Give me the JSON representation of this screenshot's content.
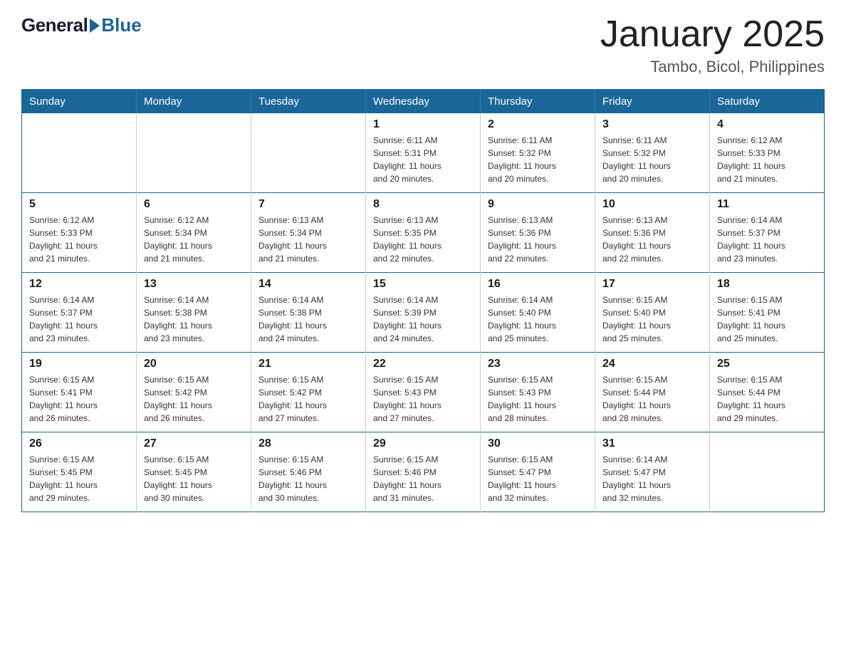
{
  "header": {
    "logo_general": "General",
    "logo_blue": "Blue",
    "month_title": "January 2025",
    "location": "Tambo, Bicol, Philippines"
  },
  "days_of_week": [
    "Sunday",
    "Monday",
    "Tuesday",
    "Wednesday",
    "Thursday",
    "Friday",
    "Saturday"
  ],
  "weeks": [
    [
      {
        "day": "",
        "info": ""
      },
      {
        "day": "",
        "info": ""
      },
      {
        "day": "",
        "info": ""
      },
      {
        "day": "1",
        "info": "Sunrise: 6:11 AM\nSunset: 5:31 PM\nDaylight: 11 hours\nand 20 minutes."
      },
      {
        "day": "2",
        "info": "Sunrise: 6:11 AM\nSunset: 5:32 PM\nDaylight: 11 hours\nand 20 minutes."
      },
      {
        "day": "3",
        "info": "Sunrise: 6:11 AM\nSunset: 5:32 PM\nDaylight: 11 hours\nand 20 minutes."
      },
      {
        "day": "4",
        "info": "Sunrise: 6:12 AM\nSunset: 5:33 PM\nDaylight: 11 hours\nand 21 minutes."
      }
    ],
    [
      {
        "day": "5",
        "info": "Sunrise: 6:12 AM\nSunset: 5:33 PM\nDaylight: 11 hours\nand 21 minutes."
      },
      {
        "day": "6",
        "info": "Sunrise: 6:12 AM\nSunset: 5:34 PM\nDaylight: 11 hours\nand 21 minutes."
      },
      {
        "day": "7",
        "info": "Sunrise: 6:13 AM\nSunset: 5:34 PM\nDaylight: 11 hours\nand 21 minutes."
      },
      {
        "day": "8",
        "info": "Sunrise: 6:13 AM\nSunset: 5:35 PM\nDaylight: 11 hours\nand 22 minutes."
      },
      {
        "day": "9",
        "info": "Sunrise: 6:13 AM\nSunset: 5:36 PM\nDaylight: 11 hours\nand 22 minutes."
      },
      {
        "day": "10",
        "info": "Sunrise: 6:13 AM\nSunset: 5:36 PM\nDaylight: 11 hours\nand 22 minutes."
      },
      {
        "day": "11",
        "info": "Sunrise: 6:14 AM\nSunset: 5:37 PM\nDaylight: 11 hours\nand 23 minutes."
      }
    ],
    [
      {
        "day": "12",
        "info": "Sunrise: 6:14 AM\nSunset: 5:37 PM\nDaylight: 11 hours\nand 23 minutes."
      },
      {
        "day": "13",
        "info": "Sunrise: 6:14 AM\nSunset: 5:38 PM\nDaylight: 11 hours\nand 23 minutes."
      },
      {
        "day": "14",
        "info": "Sunrise: 6:14 AM\nSunset: 5:38 PM\nDaylight: 11 hours\nand 24 minutes."
      },
      {
        "day": "15",
        "info": "Sunrise: 6:14 AM\nSunset: 5:39 PM\nDaylight: 11 hours\nand 24 minutes."
      },
      {
        "day": "16",
        "info": "Sunrise: 6:14 AM\nSunset: 5:40 PM\nDaylight: 11 hours\nand 25 minutes."
      },
      {
        "day": "17",
        "info": "Sunrise: 6:15 AM\nSunset: 5:40 PM\nDaylight: 11 hours\nand 25 minutes."
      },
      {
        "day": "18",
        "info": "Sunrise: 6:15 AM\nSunset: 5:41 PM\nDaylight: 11 hours\nand 25 minutes."
      }
    ],
    [
      {
        "day": "19",
        "info": "Sunrise: 6:15 AM\nSunset: 5:41 PM\nDaylight: 11 hours\nand 26 minutes."
      },
      {
        "day": "20",
        "info": "Sunrise: 6:15 AM\nSunset: 5:42 PM\nDaylight: 11 hours\nand 26 minutes."
      },
      {
        "day": "21",
        "info": "Sunrise: 6:15 AM\nSunset: 5:42 PM\nDaylight: 11 hours\nand 27 minutes."
      },
      {
        "day": "22",
        "info": "Sunrise: 6:15 AM\nSunset: 5:43 PM\nDaylight: 11 hours\nand 27 minutes."
      },
      {
        "day": "23",
        "info": "Sunrise: 6:15 AM\nSunset: 5:43 PM\nDaylight: 11 hours\nand 28 minutes."
      },
      {
        "day": "24",
        "info": "Sunrise: 6:15 AM\nSunset: 5:44 PM\nDaylight: 11 hours\nand 28 minutes."
      },
      {
        "day": "25",
        "info": "Sunrise: 6:15 AM\nSunset: 5:44 PM\nDaylight: 11 hours\nand 29 minutes."
      }
    ],
    [
      {
        "day": "26",
        "info": "Sunrise: 6:15 AM\nSunset: 5:45 PM\nDaylight: 11 hours\nand 29 minutes."
      },
      {
        "day": "27",
        "info": "Sunrise: 6:15 AM\nSunset: 5:45 PM\nDaylight: 11 hours\nand 30 minutes."
      },
      {
        "day": "28",
        "info": "Sunrise: 6:15 AM\nSunset: 5:46 PM\nDaylight: 11 hours\nand 30 minutes."
      },
      {
        "day": "29",
        "info": "Sunrise: 6:15 AM\nSunset: 5:46 PM\nDaylight: 11 hours\nand 31 minutes."
      },
      {
        "day": "30",
        "info": "Sunrise: 6:15 AM\nSunset: 5:47 PM\nDaylight: 11 hours\nand 32 minutes."
      },
      {
        "day": "31",
        "info": "Sunrise: 6:14 AM\nSunset: 5:47 PM\nDaylight: 11 hours\nand 32 minutes."
      },
      {
        "day": "",
        "info": ""
      }
    ]
  ]
}
